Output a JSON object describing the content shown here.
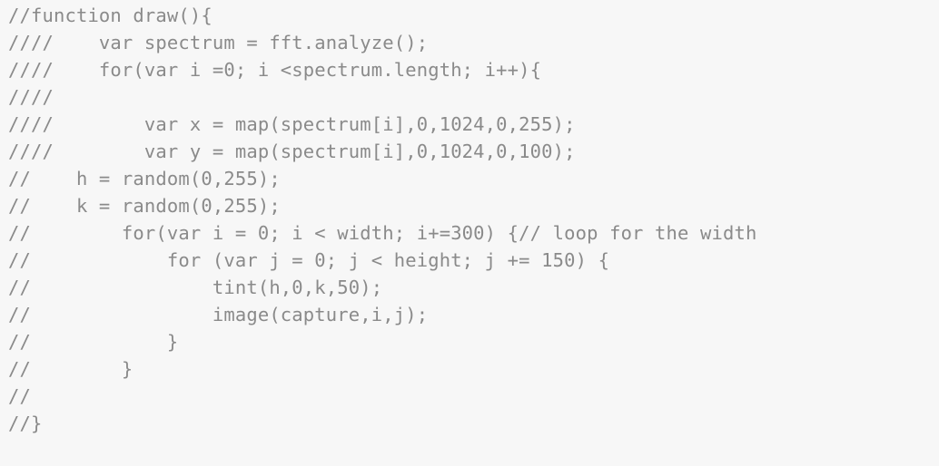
{
  "editor": {
    "lines": [
      "//function draw(){",
      "////    var spectrum = fft.analyze();",
      "////    for(var i =0; i <spectrum.length; i++){",
      "////",
      "////        var x = map(spectrum[i],0,1024,0,255);",
      "////        var y = map(spectrum[i],0,1024,0,100);",
      "//    h = random(0,255);",
      "//    k = random(0,255);",
      "//        for(var i = 0; i < width; i+=300) {// loop for the width",
      "//            for (var j = 0; j < height; j += 150) {",
      "//                tint(h,0,k,50);",
      "//                image(capture,i,j);",
      "//            }",
      "//        }",
      "//",
      "//}"
    ],
    "text_color": "#8a8a8a",
    "background_color": "#f7f7f7"
  }
}
